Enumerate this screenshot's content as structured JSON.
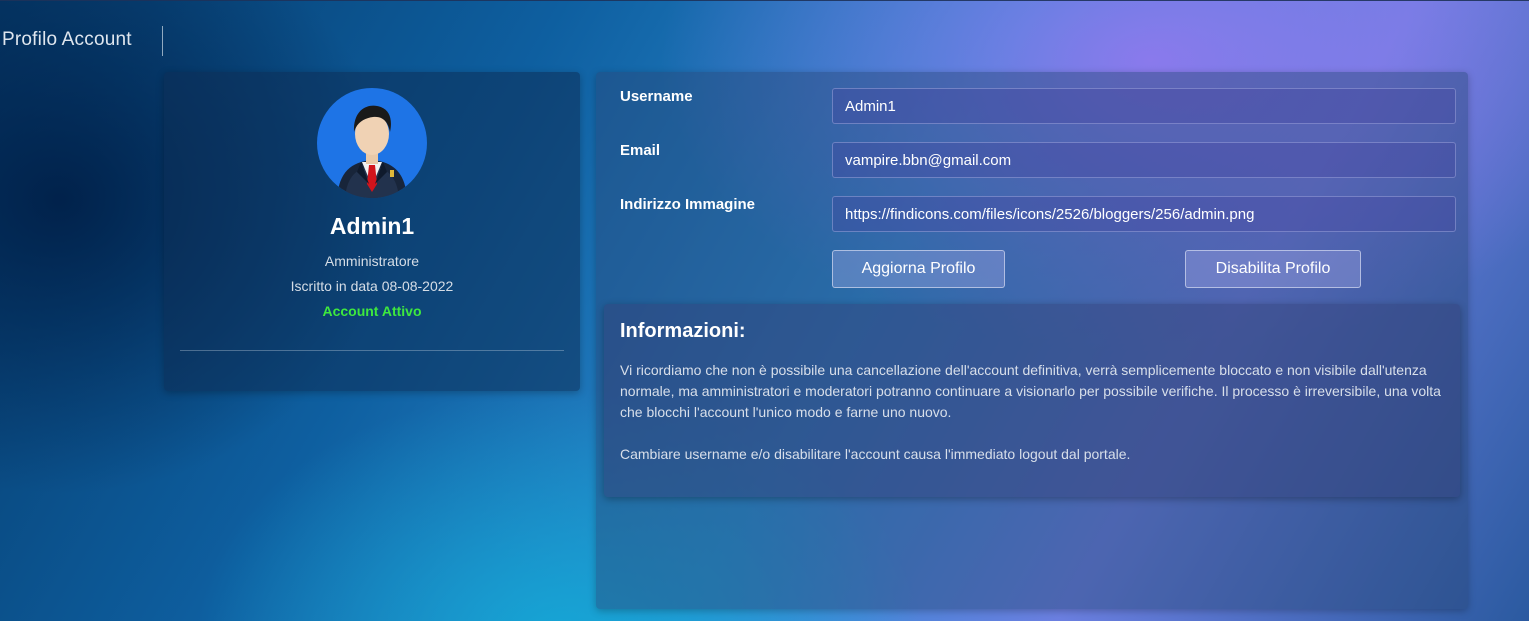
{
  "header": {
    "title": "Profilo Account"
  },
  "profile": {
    "avatar_icon": "businessman-avatar-icon",
    "name": "Admin1",
    "role": "Amministratore",
    "joined": "Iscritto in data 08-08-2022",
    "status": "Account Attivo",
    "status_color": "#3ee83e"
  },
  "form": {
    "username_label": "Username",
    "username_value": "Admin1",
    "email_label": "Email",
    "email_value": "vampire.bbn@gmail.com",
    "image_label": "Indirizzo Immagine",
    "image_value": "https://findicons.com/files/icons/2526/bloggers/256/admin.png",
    "update_button": "Aggiorna Profilo",
    "disable_button": "Disabilita Profilo"
  },
  "info": {
    "title": "Informazioni:",
    "paragraph1": "Vi ricordiamo che non è possibile una cancellazione dell'account definitiva, verrà semplicemente bloccato e non visibile dall'utenza normale, ma amministratori e moderatori potranno continuare a visionarlo per possibile verifiche. Il processo è irreversibile, una volta che blocchi l'account l'unico modo e farne uno nuovo.",
    "paragraph2": "Cambiare username e/o disabilitare l'account causa l'immediato logout dal portale."
  }
}
